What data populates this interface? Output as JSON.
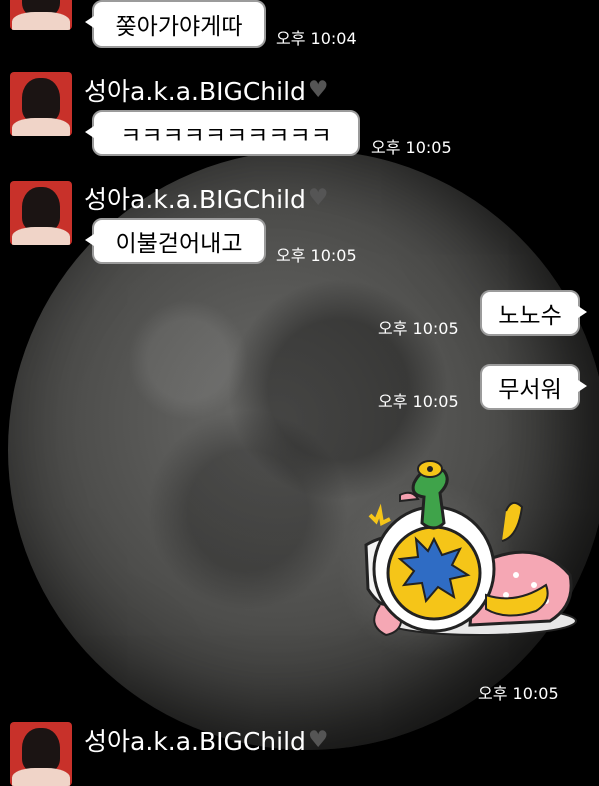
{
  "chat": {
    "messages": [
      {
        "text": "쫒아가야게따",
        "time": "오후 10:04"
      },
      {
        "sender": "성아a.k.a.BIGChild",
        "text": "ㅋㅋㅋㅋㅋㅋㅋㅋㅋㅋ",
        "time": "오후 10:05"
      },
      {
        "sender": "성아a.k.a.BIGChild",
        "text": "이불걷어내고",
        "time": "오후 10:05"
      },
      {
        "text": "노노수",
        "time": "오후 10:05"
      },
      {
        "text": "무서워",
        "time": "오후 10:05"
      },
      {
        "sticker": "duck-in-cup-sticker",
        "time": "오후 10:05"
      },
      {
        "sender": "성아a.k.a.BIGChild"
      }
    ]
  },
  "colors": {
    "background": "#000000",
    "bubble": "#ffffff",
    "bubble_border": "#9b9b9b",
    "avatar_bg": "#c8312a"
  },
  "icons": {
    "heart": "black-heart-icon"
  }
}
